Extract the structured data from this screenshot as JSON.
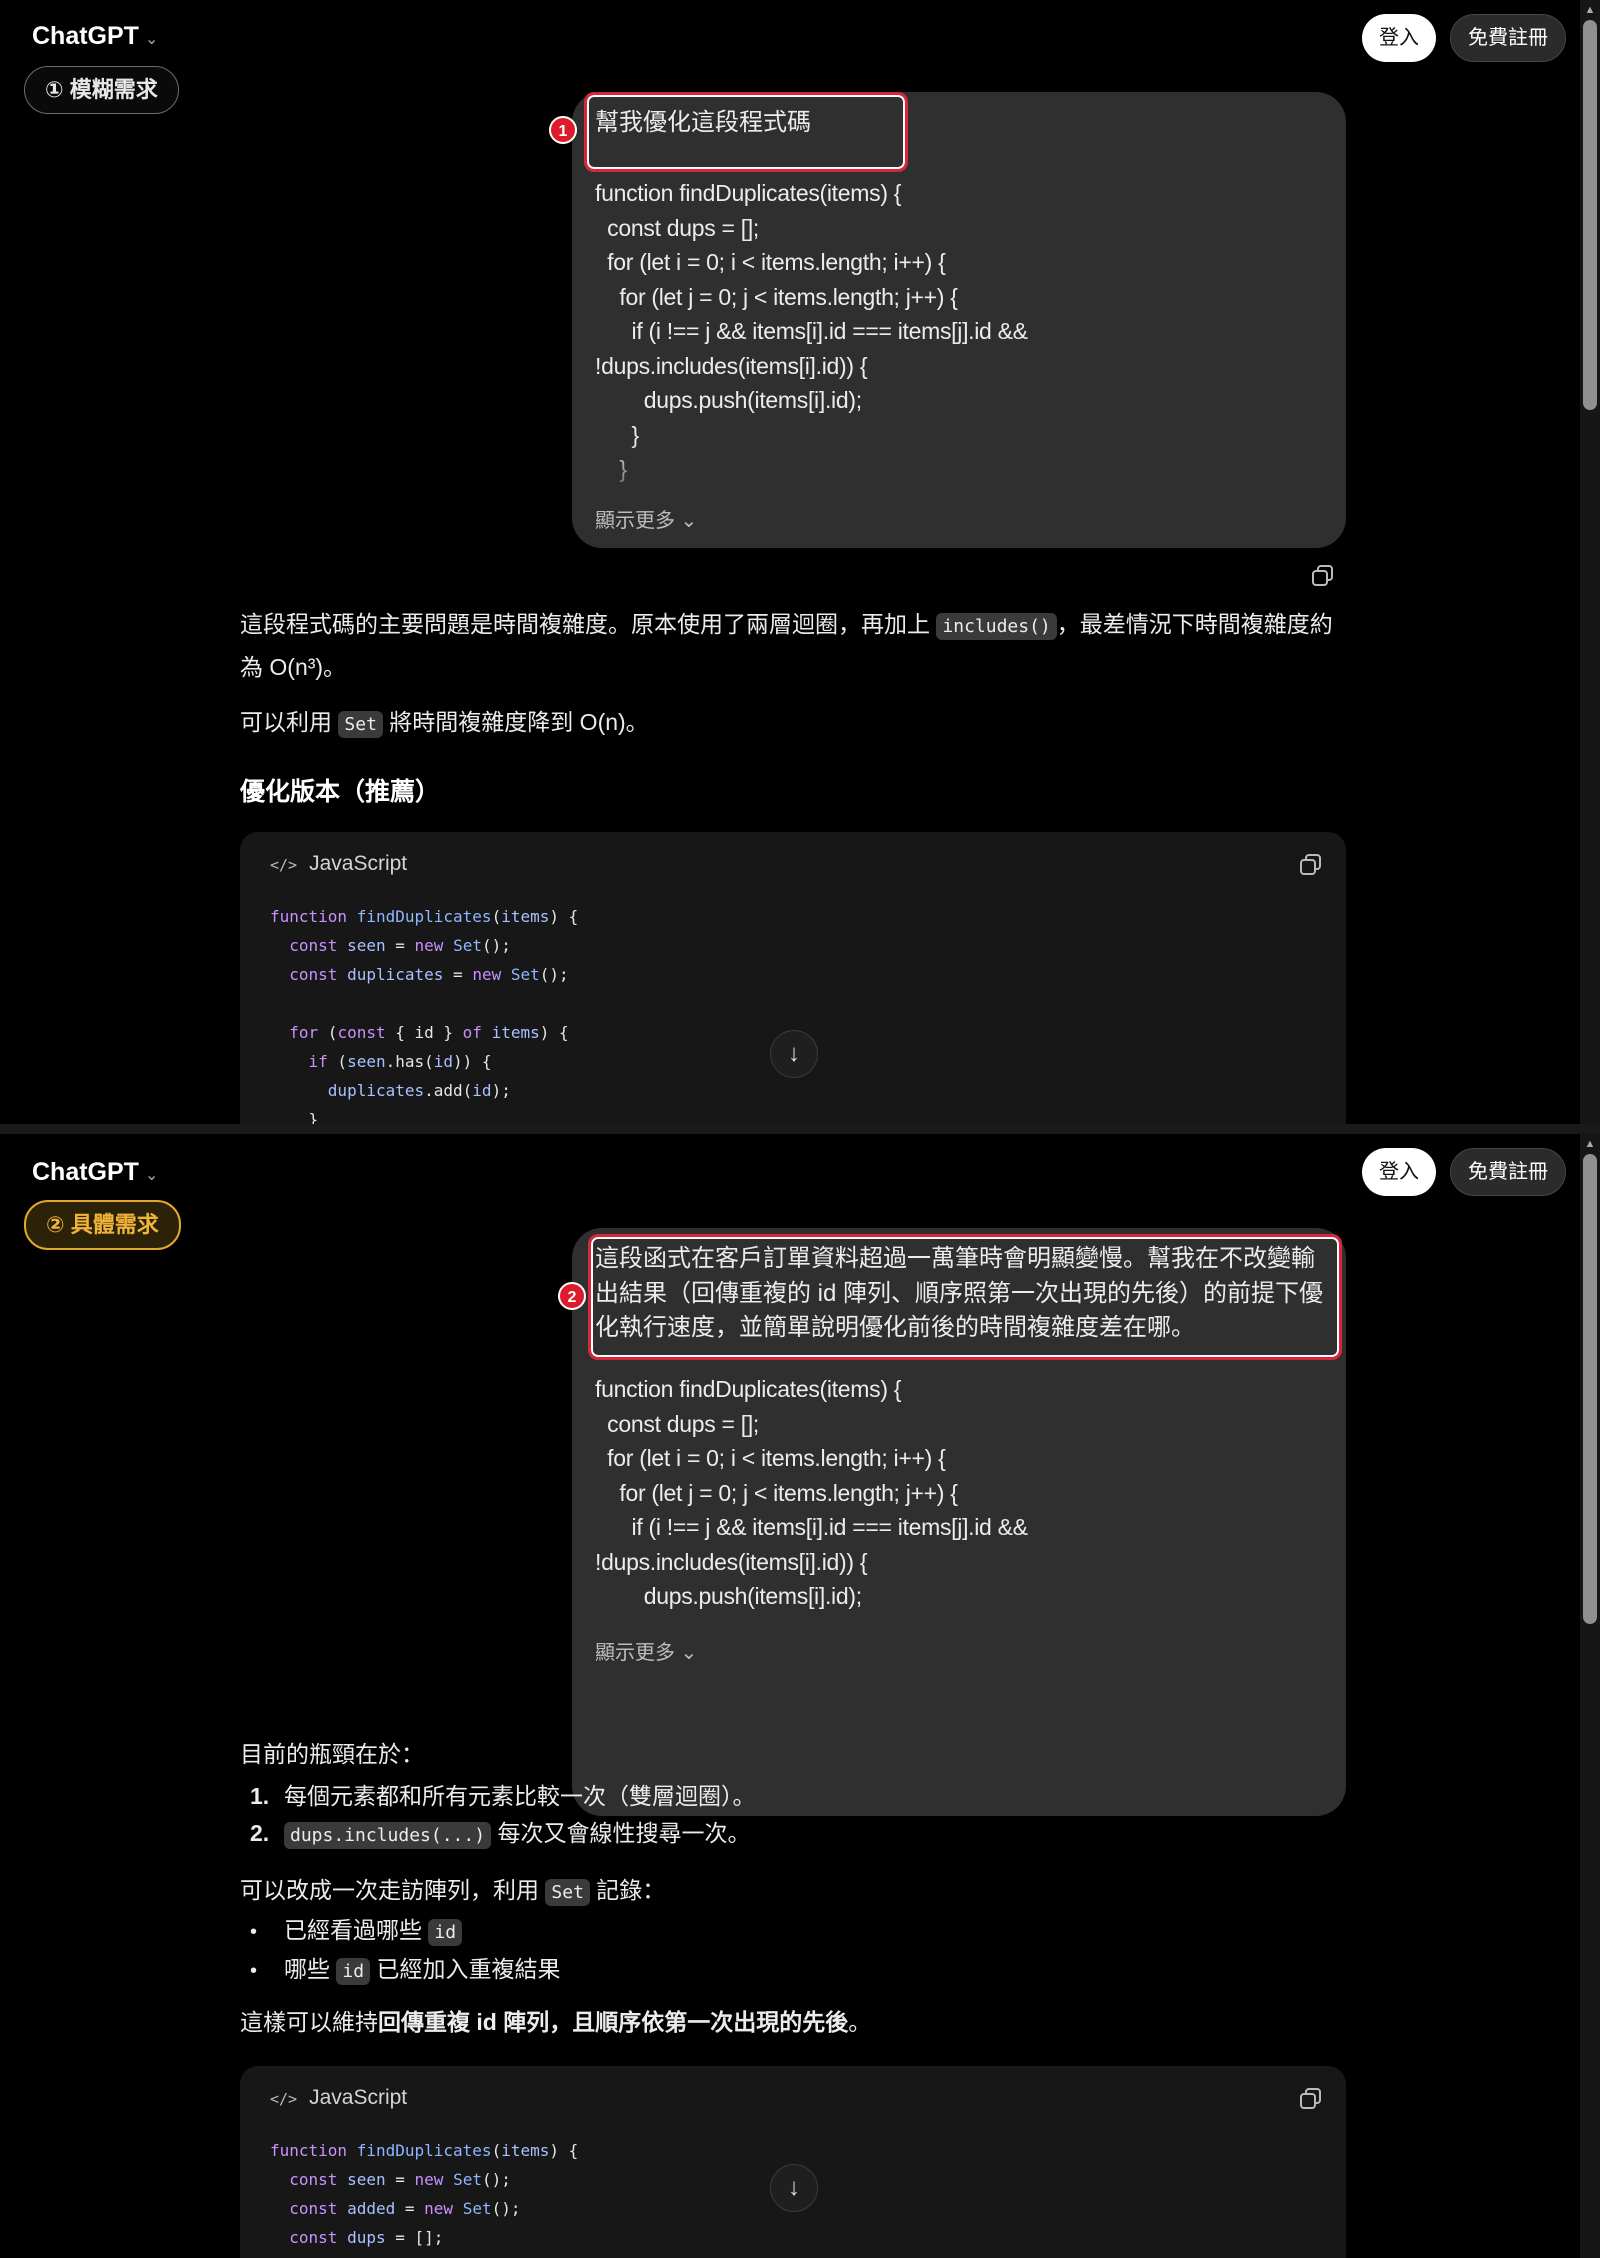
{
  "header": {
    "brand": "ChatGPT",
    "brand_chevron": "⌄",
    "login": "登入",
    "signup": "免費註冊"
  },
  "labels": {
    "vague": "① 模糊需求",
    "specific": "② 具體需求"
  },
  "markers": {
    "one": "1",
    "two": "2"
  },
  "panel1": {
    "prompt": "幫我優化這段程式碼",
    "code": [
      "function findDuplicates(items) {",
      "  const dups = [];",
      "  for (let i = 0; i < items.length; i++) {",
      "    for (let j = 0; j < items.length; j++) {",
      "      if (i !== j && items[i].id === items[j].id &&",
      "!dups.includes(items[i].id)) {",
      "        dups.push(items[i].id);",
      "      }",
      "    }"
    ],
    "show_more": "顯示更多 ⌄",
    "answer_p1_a": "這段程式碼的主要問題是時間複雜度。原本使用了兩層迴圈，再加上",
    "answer_p1_code": "includes()",
    "answer_p1_b": "，最差情況下時間複雜度約",
    "answer_p1_c": "為 O(n³)。",
    "answer_p2_a": "可以利用",
    "answer_p2_code": "Set",
    "answer_p2_b": "將時間複雜度降到 O(n)。",
    "heading": "優化版本（推薦）",
    "code_lang": "JavaScript",
    "code_tag": "</>"
  },
  "panel2": {
    "prompt": "這段函式在客戶訂單資料超過一萬筆時會明顯變慢。幫我在不改變輸出結果（回傳重複的 id 陣列、順序照第一次出現的先後）的前提下優化執行速度，並簡單說明優化前後的時間複雜度差在哪。",
    "code": [
      "function findDuplicates(items) {",
      "  const dups = [];",
      "  for (let i = 0; i < items.length; i++) {",
      "    for (let j = 0; j < items.length; j++) {",
      "      if (i !== j && items[i].id === items[j].id &&",
      "!dups.includes(items[i].id)) {",
      "        dups.push(items[i].id);"
    ],
    "show_more": "顯示更多 ⌄",
    "intro": "目前的瓶頸在於：",
    "ol": [
      {
        "num": "1.",
        "text": "每個元素都和所有元素比較一次（雙層迴圈）。"
      },
      {
        "num": "2.",
        "code": "dups.includes(...)",
        "text": " 每次又會線性搜尋一次。"
      }
    ],
    "p2_a": "可以改成一次走訪陣列，利用",
    "p2_code": "Set",
    "p2_b": "記錄：",
    "ul": [
      {
        "pre": "已經看過哪些",
        "code": "id",
        "post": ""
      },
      {
        "pre": "哪些",
        "code": "id",
        "post": "已經加入重複結果"
      }
    ],
    "p3_a": "這樣可以維持",
    "p3_bold": "回傳重複 id 陣列，且順序依第一次出現的先後",
    "p3_b": "。",
    "code_lang": "JavaScript",
    "code_tag": "</>"
  }
}
